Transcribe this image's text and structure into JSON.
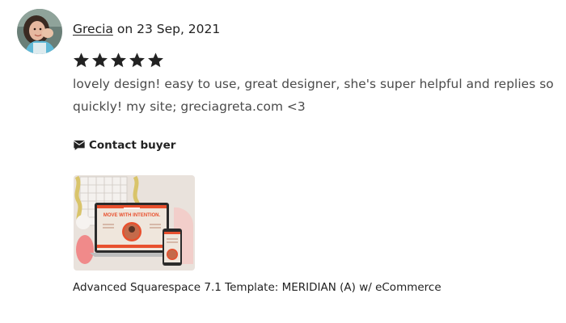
{
  "review": {
    "reviewer_name": "Grecia",
    "date_prefix": "on",
    "date": "23 Sep, 2021",
    "rating": 5,
    "rating_max": 5,
    "text_line_1": "lovely design! easy to use, great designer, she's super helpful and replies so",
    "text_line_2": "quickly! my site; greciagreta.com <3"
  },
  "actions": {
    "contact_label": "Contact buyer",
    "contact_icon": "message-icon"
  },
  "product": {
    "title": "Advanced Squarespace 7.1 Template: MERIDIAN (A) w/ eCommerce",
    "thumbnail_heading": "MOVE WITH INTENTION."
  },
  "colors": {
    "star": "#222222",
    "text": "#222222",
    "review_text": "#4a4a4a",
    "thumb_background": "#e9e2dc",
    "thumb_accent": "#e8502e"
  }
}
